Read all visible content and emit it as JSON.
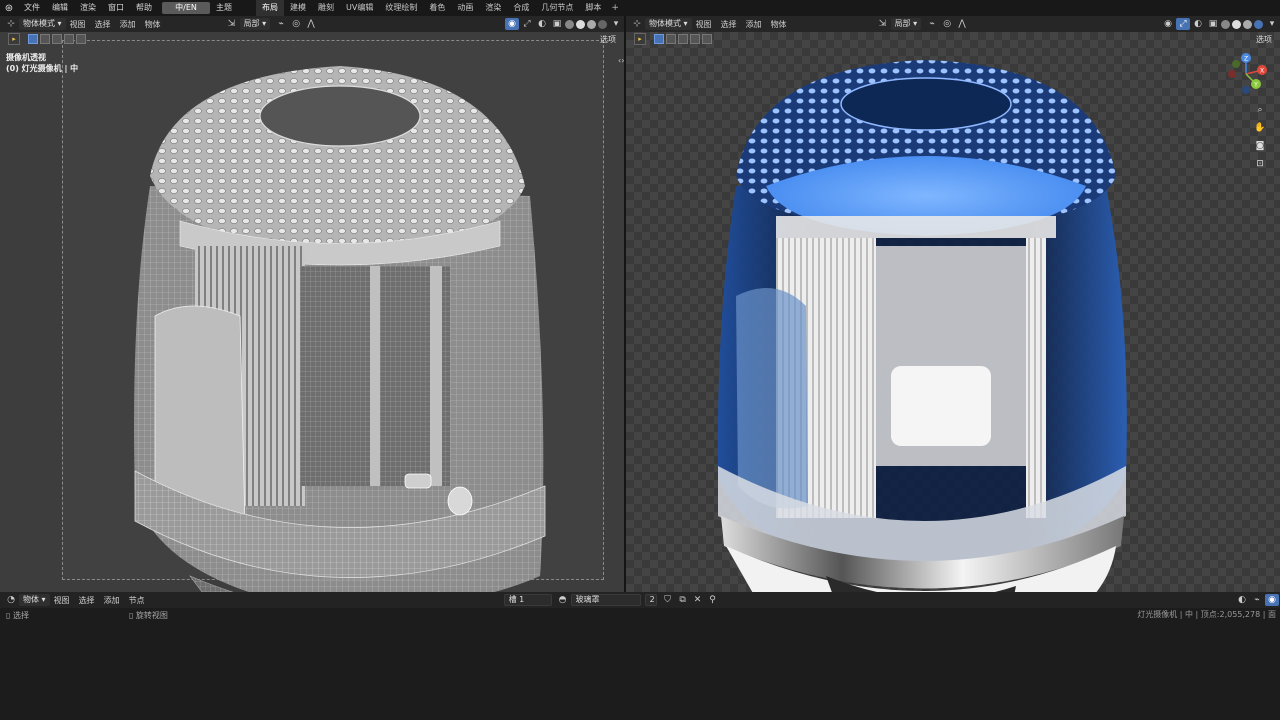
{
  "topbar": {
    "menu": [
      "文件",
      "编辑",
      "渲染",
      "窗口",
      "帮助"
    ],
    "lang": "中/EN",
    "theme": "主题",
    "tabs": [
      "布局",
      "建模",
      "雕刻",
      "UV编辑",
      "纹理绘制",
      "着色",
      "动画",
      "渲染",
      "合成",
      "几何节点",
      "脚本"
    ],
    "active_tab": "布局",
    "plus": "+"
  },
  "left_viewport": {
    "mode": "物体模式",
    "menus": [
      "视图",
      "选择",
      "添加",
      "物体"
    ],
    "pivot": "局部",
    "options": "选项",
    "overlay_title": "摄像机透视",
    "overlay_sub": "(0) 灯光摄像机 | 中"
  },
  "right_viewport": {
    "mode": "物体模式",
    "menus": [
      "视图",
      "选择",
      "添加",
      "物体"
    ],
    "pivot": "局部",
    "options": "选项",
    "gizmo_axes": {
      "x": "X",
      "y": "Y",
      "z": "Z"
    }
  },
  "bottom": {
    "mode": "物体",
    "menus": [
      "视图",
      "选择",
      "添加",
      "节点"
    ],
    "slot": "槽 1",
    "material": "玻璃罩",
    "users": "2"
  },
  "status": {
    "select": "选择",
    "rotate": "旋转视图",
    "right": "灯光摄像机 | 中 | 顶点:2,055,278 | 面"
  },
  "colors": {
    "accent": "#4772b3",
    "glass_blue": "#2f74e0"
  }
}
